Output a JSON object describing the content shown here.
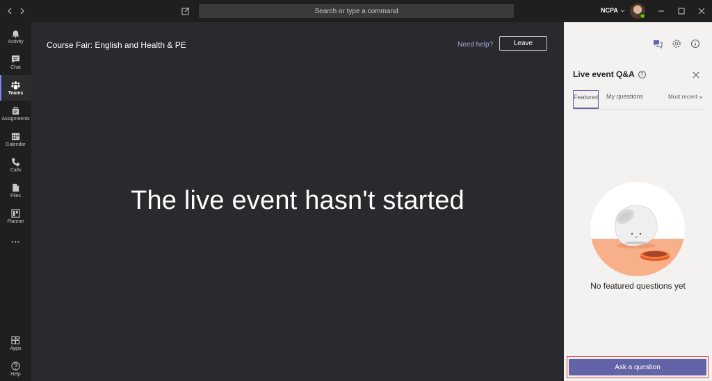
{
  "titlebar": {
    "search_placeholder": "Search or type a command",
    "org_name": "NCPA"
  },
  "rail": {
    "items": [
      {
        "label": "Activity",
        "icon": "bell-icon"
      },
      {
        "label": "Chat",
        "icon": "chat-icon"
      },
      {
        "label": "Teams",
        "icon": "teams-icon",
        "active": true
      },
      {
        "label": "Assignments",
        "icon": "assignments-icon"
      },
      {
        "label": "Calendar",
        "icon": "calendar-icon"
      },
      {
        "label": "Calls",
        "icon": "phone-icon"
      },
      {
        "label": "Files",
        "icon": "file-icon"
      },
      {
        "label": "Planner",
        "icon": "planner-icon"
      }
    ],
    "more": "···",
    "bottom": [
      {
        "label": "Apps",
        "icon": "apps-icon"
      },
      {
        "label": "Help",
        "icon": "help-icon"
      }
    ]
  },
  "stage": {
    "event_title": "Course Fair: English and Health & PE",
    "need_help": "Need help?",
    "leave_label": "Leave",
    "status_message": "The live event hasn't started"
  },
  "panel": {
    "title": "Live event Q&A",
    "help_glyph": "?",
    "tabs": {
      "featured": "Featured",
      "mine": "My questions"
    },
    "sort_label": "Most recent",
    "empty_message": "No featured questions yet",
    "ask_label": "Ask a question"
  },
  "colors": {
    "accent": "#6264a7",
    "rail_active_bar": "#7f85f5",
    "stage_bg": "#2a292d",
    "panel_bg": "#f3f2f1",
    "highlight_border": "#e03b3b"
  }
}
